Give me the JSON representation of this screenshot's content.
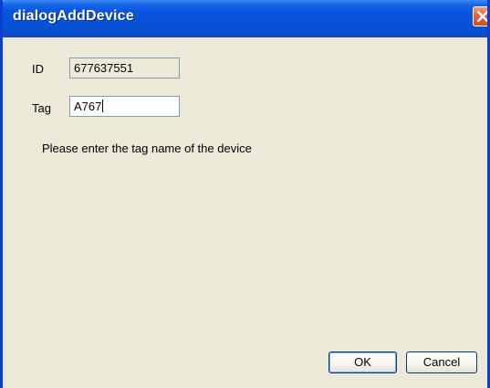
{
  "window": {
    "title": "dialogAddDevice"
  },
  "form": {
    "id_label": "ID",
    "id_value": "677637551",
    "tag_label": "Tag",
    "tag_value": "A767"
  },
  "message": "Please enter the tag name of the device",
  "buttons": {
    "ok_label": "OK",
    "cancel_label": "Cancel"
  },
  "icons": {
    "close": "close-icon"
  },
  "colors": {
    "titlebar": "#0553d8",
    "background": "#ece9d8",
    "close_button": "#e5603a"
  }
}
